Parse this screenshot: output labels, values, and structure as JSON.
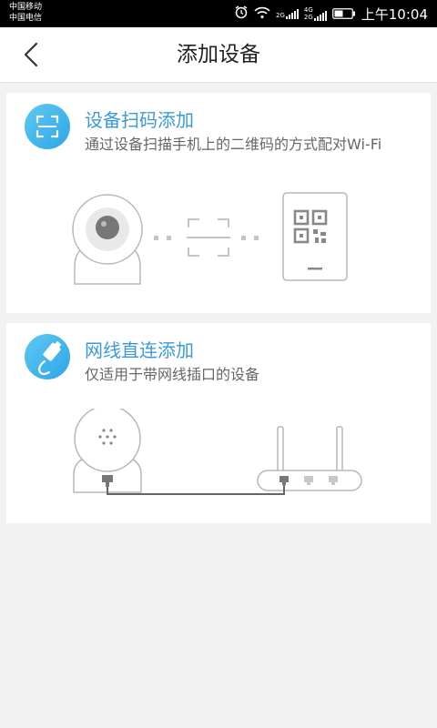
{
  "status_bar": {
    "carrier_1": "中国移动",
    "carrier_2": "中国电信",
    "net_tag_1": "2G",
    "net_tag_2": "4G",
    "net_tag_3": "2G",
    "time": "上午10:04"
  },
  "header": {
    "title": "添加设备"
  },
  "options": [
    {
      "title": "设备扫码添加",
      "description": "通过设备扫描手机上的二维码的方式配对Wi-Fi"
    },
    {
      "title": "网线直连添加",
      "description": "仅适用于带网线插口的设备"
    }
  ],
  "colors": {
    "accent": "#3a9ad9",
    "icon_gradient_start": "#5ec8f2",
    "icon_gradient_end": "#2ea6e6"
  }
}
